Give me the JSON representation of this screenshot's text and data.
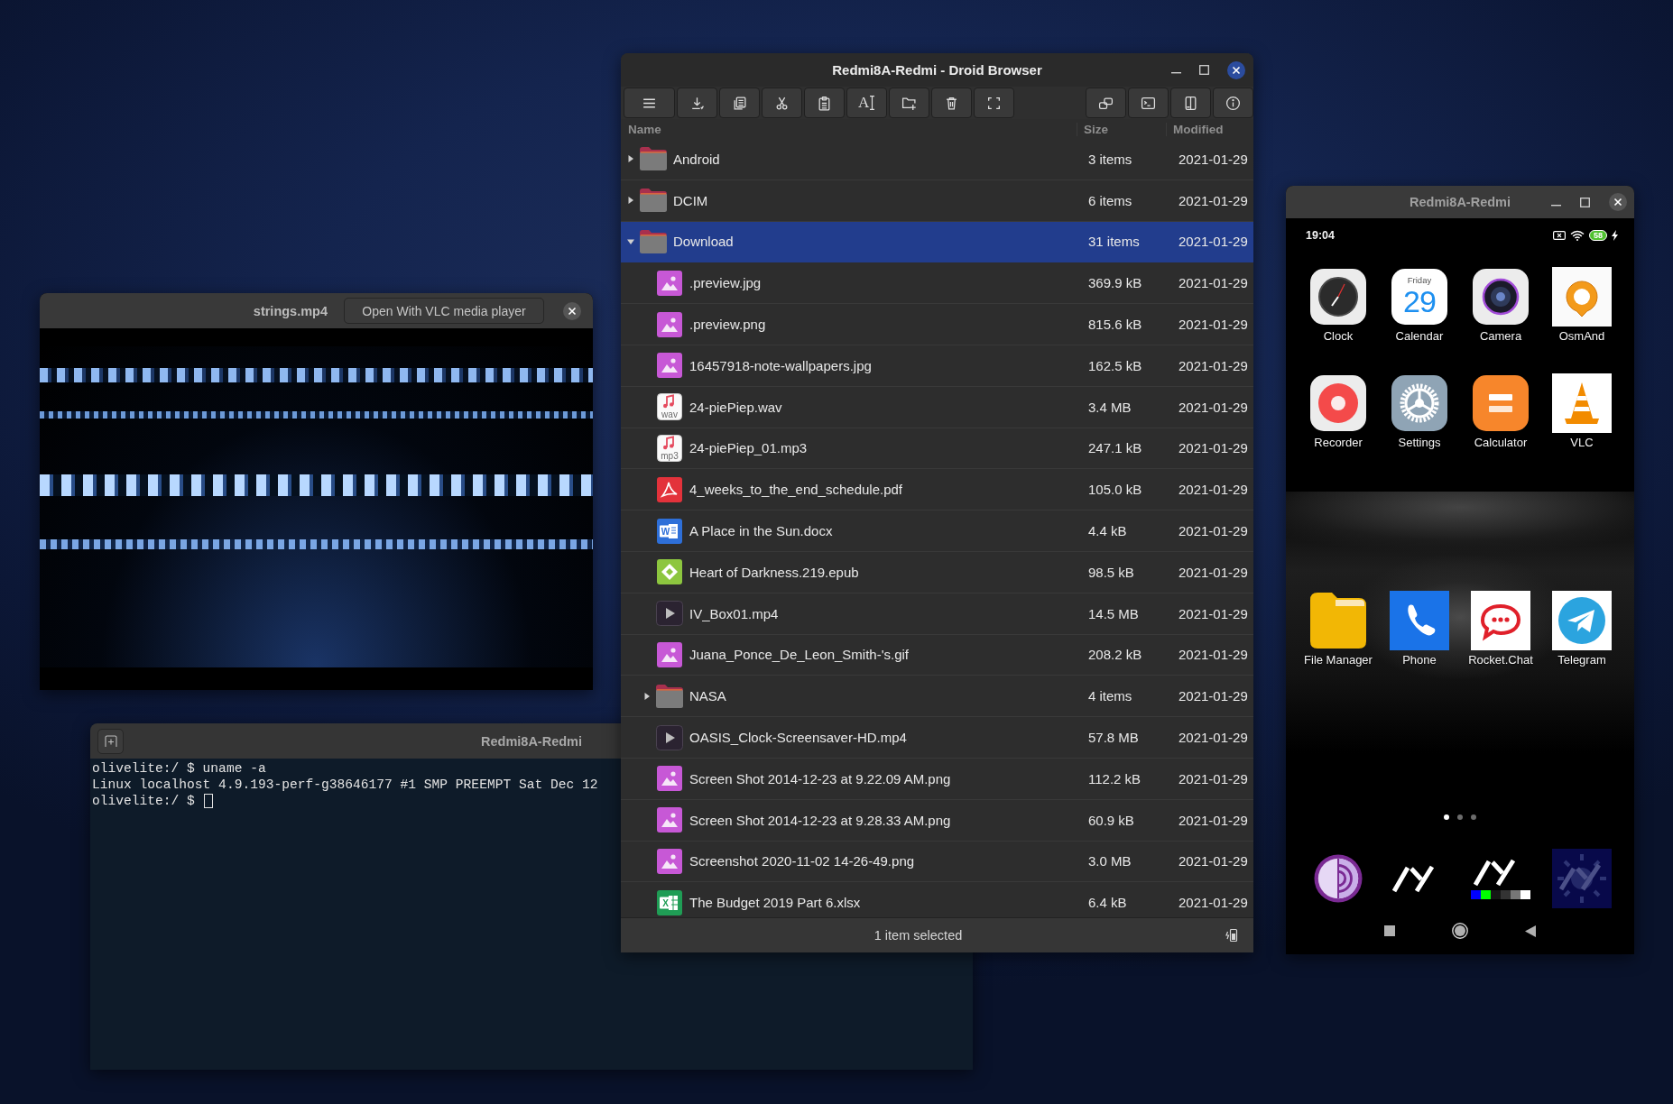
{
  "video_window": {
    "title": "strings.mp4",
    "open_button": "Open With VLC media player"
  },
  "terminal_window": {
    "title": "Redmi8A-Redmi",
    "lines": [
      "olivelite:/ $ uname -a",
      "Linux localhost 4.9.193-perf-g38646177 #1 SMP PREEMPT Sat Dec 12",
      "olivelite:/ $"
    ]
  },
  "file_browser": {
    "title": "Redmi8A-Redmi - Droid Browser",
    "rename_button_text": "A",
    "columns": [
      "Name",
      "Size",
      "Modified"
    ],
    "rows": [
      {
        "name": "Android",
        "size": "3 items",
        "modified": "2021-01-29",
        "kind": "folder",
        "expanded": false,
        "selected": false
      },
      {
        "name": "DCIM",
        "size": "6 items",
        "modified": "2021-01-29",
        "kind": "folder",
        "expanded": false,
        "selected": false
      },
      {
        "name": "Download",
        "size": "31 items",
        "modified": "2021-01-29",
        "kind": "folder",
        "expanded": true,
        "selected": true,
        "children": [
          {
            "name": ".preview.jpg",
            "size": "369.9 kB",
            "modified": "2021-01-29",
            "kind": "image",
            "selected": false
          },
          {
            "name": ".preview.png",
            "size": "815.6 kB",
            "modified": "2021-01-29",
            "kind": "image",
            "selected": false
          },
          {
            "name": "16457918-note-wallpapers.jpg",
            "size": "162.5 kB",
            "modified": "2021-01-29",
            "kind": "image",
            "selected": false
          },
          {
            "name": "24-piePiep.wav",
            "size": "3.4 MB",
            "modified": "2021-01-29",
            "kind": "audio",
            "icon_text": "wav",
            "selected": false
          },
          {
            "name": "24-piePiep_01.mp3",
            "size": "247.1 kB",
            "modified": "2021-01-29",
            "kind": "audio",
            "icon_text": "mp3",
            "selected": false
          },
          {
            "name": "4_weeks_to_the_end_schedule.pdf",
            "size": "105.0 kB",
            "modified": "2021-01-29",
            "kind": "pdf",
            "selected": false
          },
          {
            "name": "A Place in the Sun.docx",
            "size": "4.4 kB",
            "modified": "2021-01-29",
            "kind": "document",
            "icon_text": "W",
            "selected": false
          },
          {
            "name": "Heart of Darkness.219.epub",
            "size": "98.5 kB",
            "modified": "2021-01-29",
            "kind": "ebook",
            "selected": false
          },
          {
            "name": "IV_Box01.mp4",
            "size": "14.5 MB",
            "modified": "2021-01-29",
            "kind": "video",
            "selected": false
          },
          {
            "name": "Juana_Ponce_De_Leon_Smith-'s.gif",
            "size": "208.2 kB",
            "modified": "2021-01-29",
            "kind": "image",
            "selected": false
          },
          {
            "name": "NASA",
            "size": "4 items",
            "modified": "2021-01-29",
            "kind": "folder",
            "expanded": false,
            "selected": false
          },
          {
            "name": "OASIS_Clock-Screensaver-HD.mp4",
            "size": "57.8 MB",
            "modified": "2021-01-29",
            "kind": "video",
            "selected": false
          },
          {
            "name": "Screen Shot 2014-12-23 at 9.22.09 AM.png",
            "size": "112.2 kB",
            "modified": "2021-01-29",
            "kind": "image",
            "selected": false
          },
          {
            "name": "Screen Shot 2014-12-23 at 9.28.33 AM.png",
            "size": "60.9 kB",
            "modified": "2021-01-29",
            "kind": "image",
            "selected": false
          },
          {
            "name": "Screenshot 2020-11-02 14-26-49.png",
            "size": "3.0 MB",
            "modified": "2021-01-29",
            "kind": "image",
            "selected": false
          },
          {
            "name": "The Budget 2019 Part 6.xlsx",
            "size": "6.4 kB",
            "modified": "2021-01-29",
            "kind": "spreadsheet",
            "icon_text": "X",
            "selected": false
          }
        ]
      }
    ],
    "status": "1 item selected"
  },
  "phone_window": {
    "title": "Redmi8A-Redmi",
    "time": "19:04",
    "battery": "58",
    "app_rows": [
      [
        {
          "label": "Clock",
          "kind": "clock"
        },
        {
          "label": "Calendar",
          "kind": "calendar",
          "weekday": "Friday",
          "day": "29"
        },
        {
          "label": "Camera",
          "kind": "camera"
        },
        {
          "label": "OsmAnd",
          "kind": "map"
        }
      ],
      [
        {
          "label": "Recorder",
          "kind": "recorder"
        },
        {
          "label": "Settings",
          "kind": "settings"
        },
        {
          "label": "Calculator",
          "kind": "calculator"
        },
        {
          "label": "VLC",
          "kind": "cone"
        }
      ],
      [
        {
          "label": "File Manager",
          "kind": "files"
        },
        {
          "label": "Phone",
          "kind": "phone"
        },
        {
          "label": "Rocket.Chat",
          "kind": "chat"
        },
        {
          "label": "Telegram",
          "kind": "plane"
        }
      ]
    ],
    "pages": [
      {
        "selected": true
      },
      {
        "selected": false
      },
      {
        "selected": false
      }
    ]
  }
}
